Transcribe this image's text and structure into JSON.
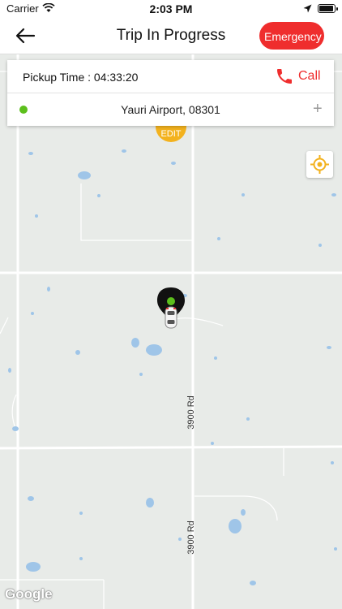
{
  "status": {
    "carrier": "Carrier",
    "time": "2:03 PM"
  },
  "nav": {
    "title": "Trip In Progress",
    "emergency_label": "Emergency"
  },
  "trip": {
    "pickup_time": "Pickup Time : 04:33:20",
    "call_label": "Call",
    "destination": "Yauri Airport, 08301",
    "add_label": "+"
  },
  "map": {
    "edit_label": "EDIT",
    "road_label_1": "3900 Rd",
    "road_label_2": "3900 Rd",
    "attribution": "Google"
  },
  "colors": {
    "accent": "#ef2d2d",
    "pickup_dot": "#5cbf1c",
    "edit": "#f3b21e",
    "water": "#9fc5e8"
  },
  "icons": [
    "back-arrow-icon",
    "wifi-icon",
    "location-arrow-icon",
    "battery-icon",
    "phone-icon",
    "plus-icon",
    "crosshair-icon",
    "car-icon",
    "pin-icon"
  ]
}
